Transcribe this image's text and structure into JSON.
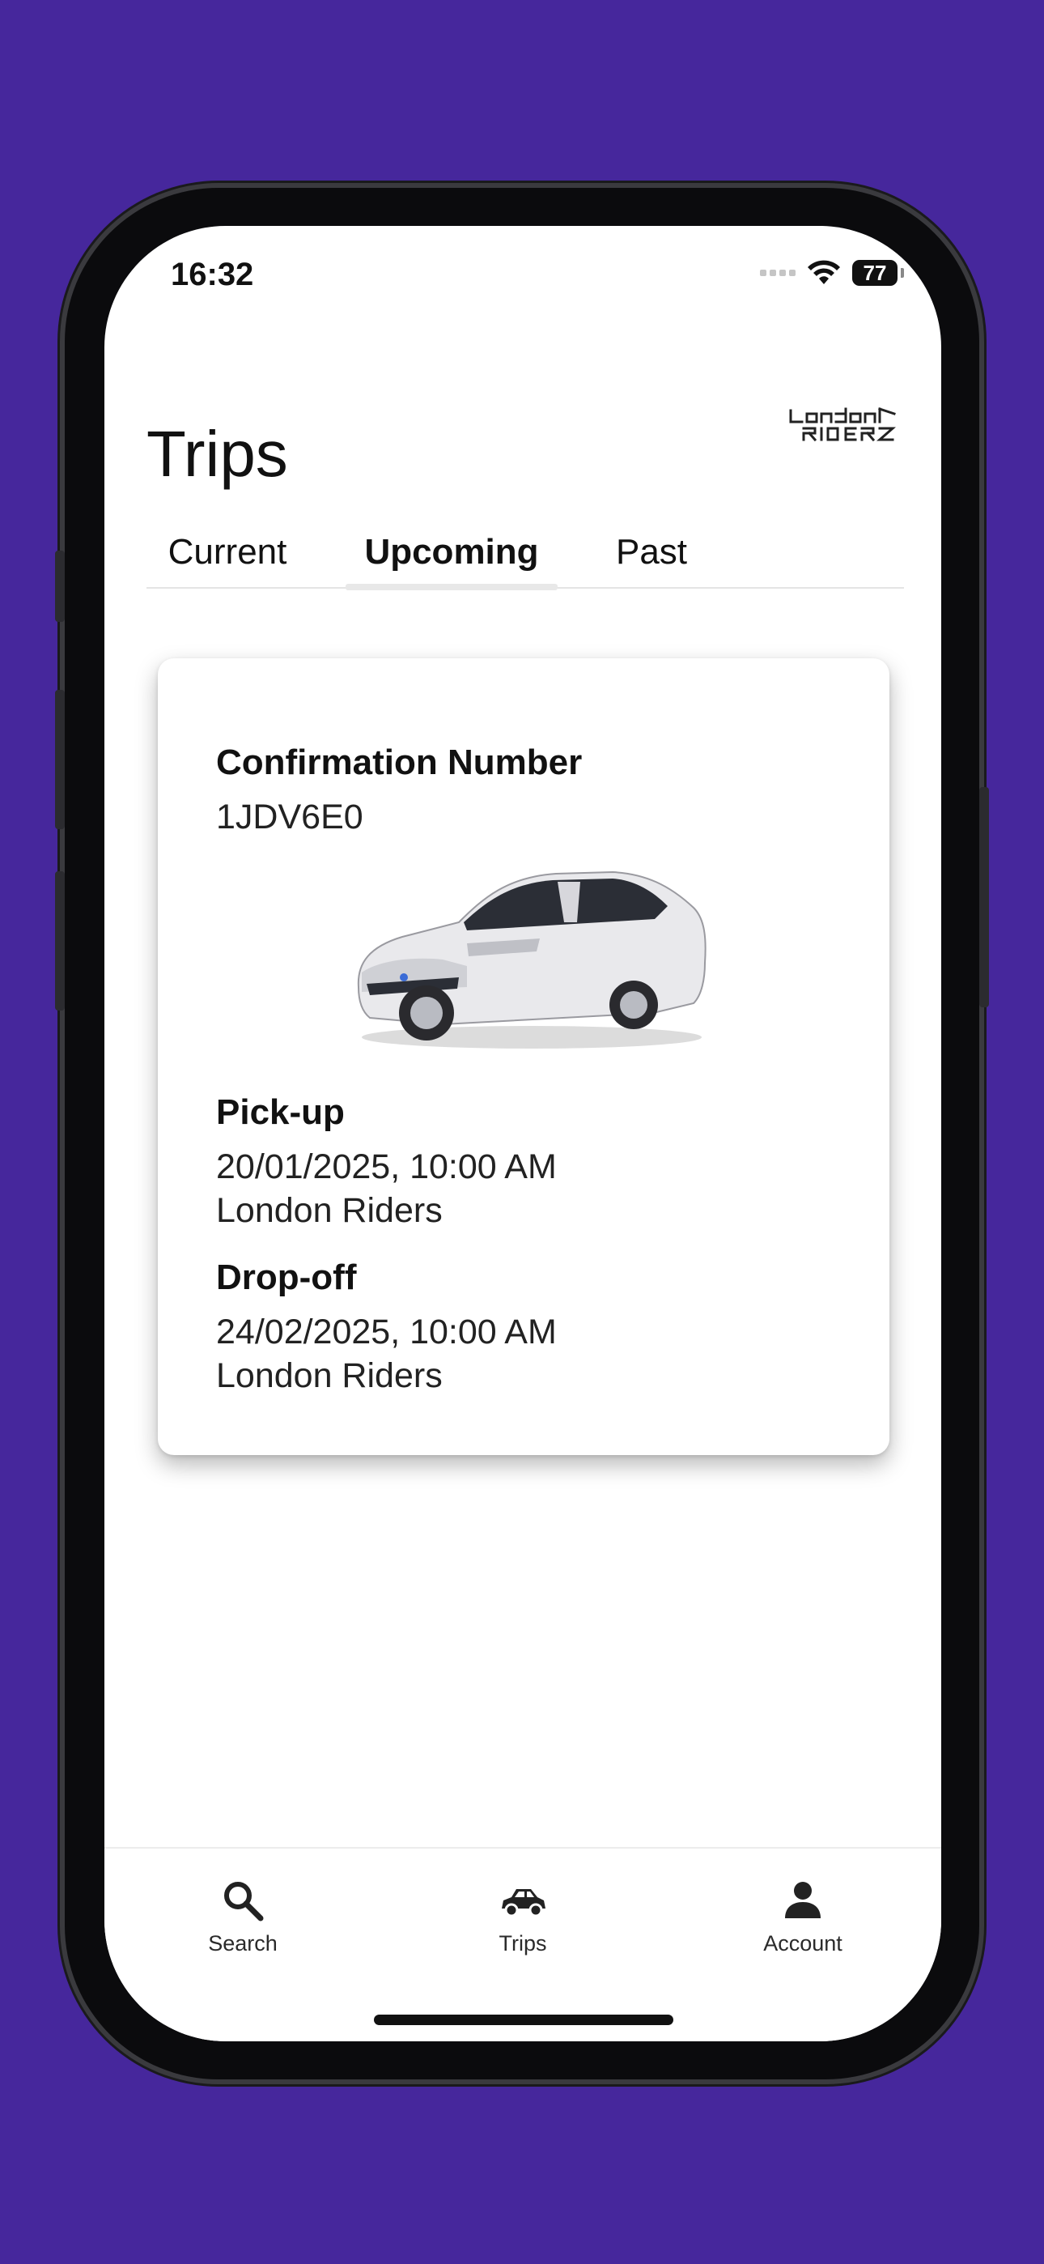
{
  "status_bar": {
    "time": "16:32",
    "battery": "77",
    "icons": [
      "signal-icon",
      "wifi-icon",
      "battery-icon"
    ]
  },
  "header": {
    "title": "Trips",
    "logo_text": "London Riders"
  },
  "tabs": [
    {
      "label": "Current",
      "active": false
    },
    {
      "label": "Upcoming",
      "active": true
    },
    {
      "label": "Past",
      "active": false
    }
  ],
  "booking": {
    "confirmation_label": "Confirmation Number",
    "confirmation_number": "1JDV6E0",
    "pickup_label": "Pick-up",
    "pickup_datetime": "20/01/2025, 10:00 AM",
    "pickup_location": "London Riders",
    "dropoff_label": "Drop-off",
    "dropoff_datetime": "24/02/2025, 10:00 AM",
    "dropoff_location": "London Riders"
  },
  "bottom_nav": [
    {
      "label": "Search",
      "icon": "search-icon"
    },
    {
      "label": "Trips",
      "icon": "car-icon"
    },
    {
      "label": "Account",
      "icon": "person-icon"
    }
  ],
  "colors": {
    "background": "#46279c",
    "screen": "#ffffff",
    "text": "#111111"
  }
}
